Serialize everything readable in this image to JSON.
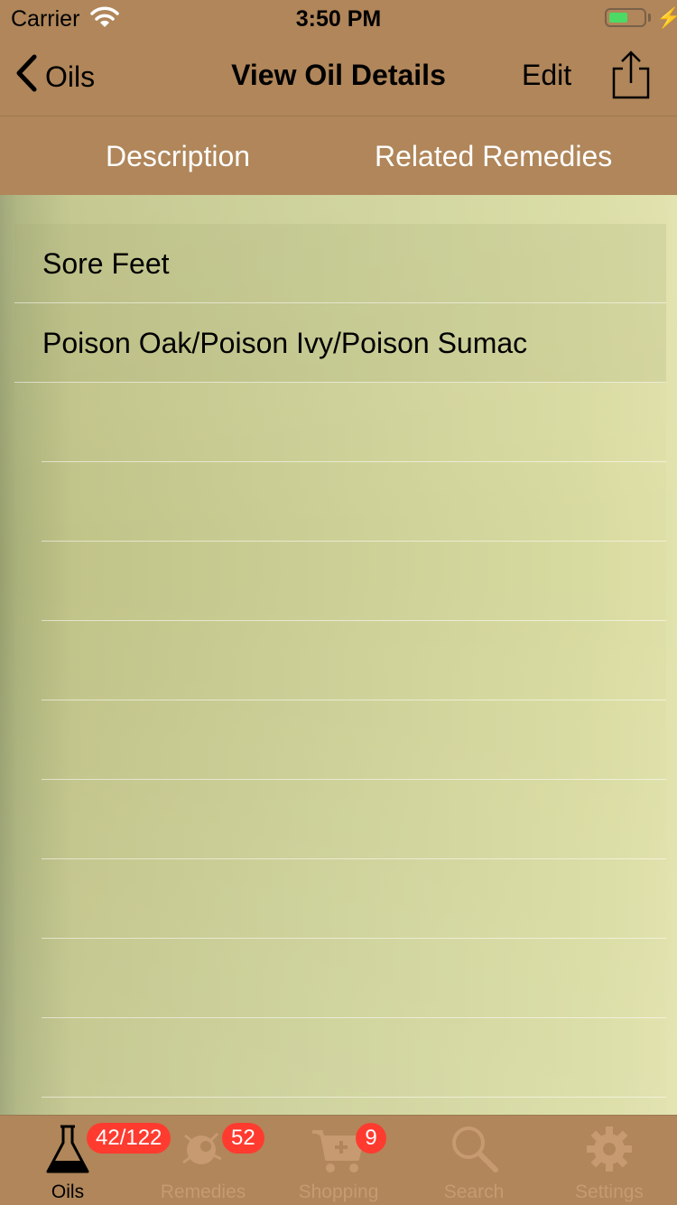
{
  "status": {
    "carrier": "Carrier",
    "time": "3:50 PM"
  },
  "nav": {
    "back_label": "Oils",
    "title": "View Oil Details",
    "edit_label": "Edit"
  },
  "segments": [
    "Description",
    "Related Remedies"
  ],
  "remedies": [
    "Sore Feet",
    "Poison Oak/Poison Ivy/Poison Sumac"
  ],
  "tabs": [
    {
      "label": "Oils",
      "badge": "42/122",
      "icon": "flask-icon",
      "active": true
    },
    {
      "label": "Remedies",
      "badge": "52",
      "icon": "remedies-icon",
      "active": false
    },
    {
      "label": "Shopping",
      "badge": "9",
      "icon": "cart-icon",
      "active": false
    },
    {
      "label": "Search",
      "badge": "",
      "icon": "search-icon",
      "active": false
    },
    {
      "label": "Settings",
      "badge": "",
      "icon": "gear-icon",
      "active": false
    }
  ],
  "colors": {
    "bar": "#b0865a",
    "badge": "#ff3b30",
    "battery": "#4cd964",
    "inactive_tab": "#c79a72"
  }
}
